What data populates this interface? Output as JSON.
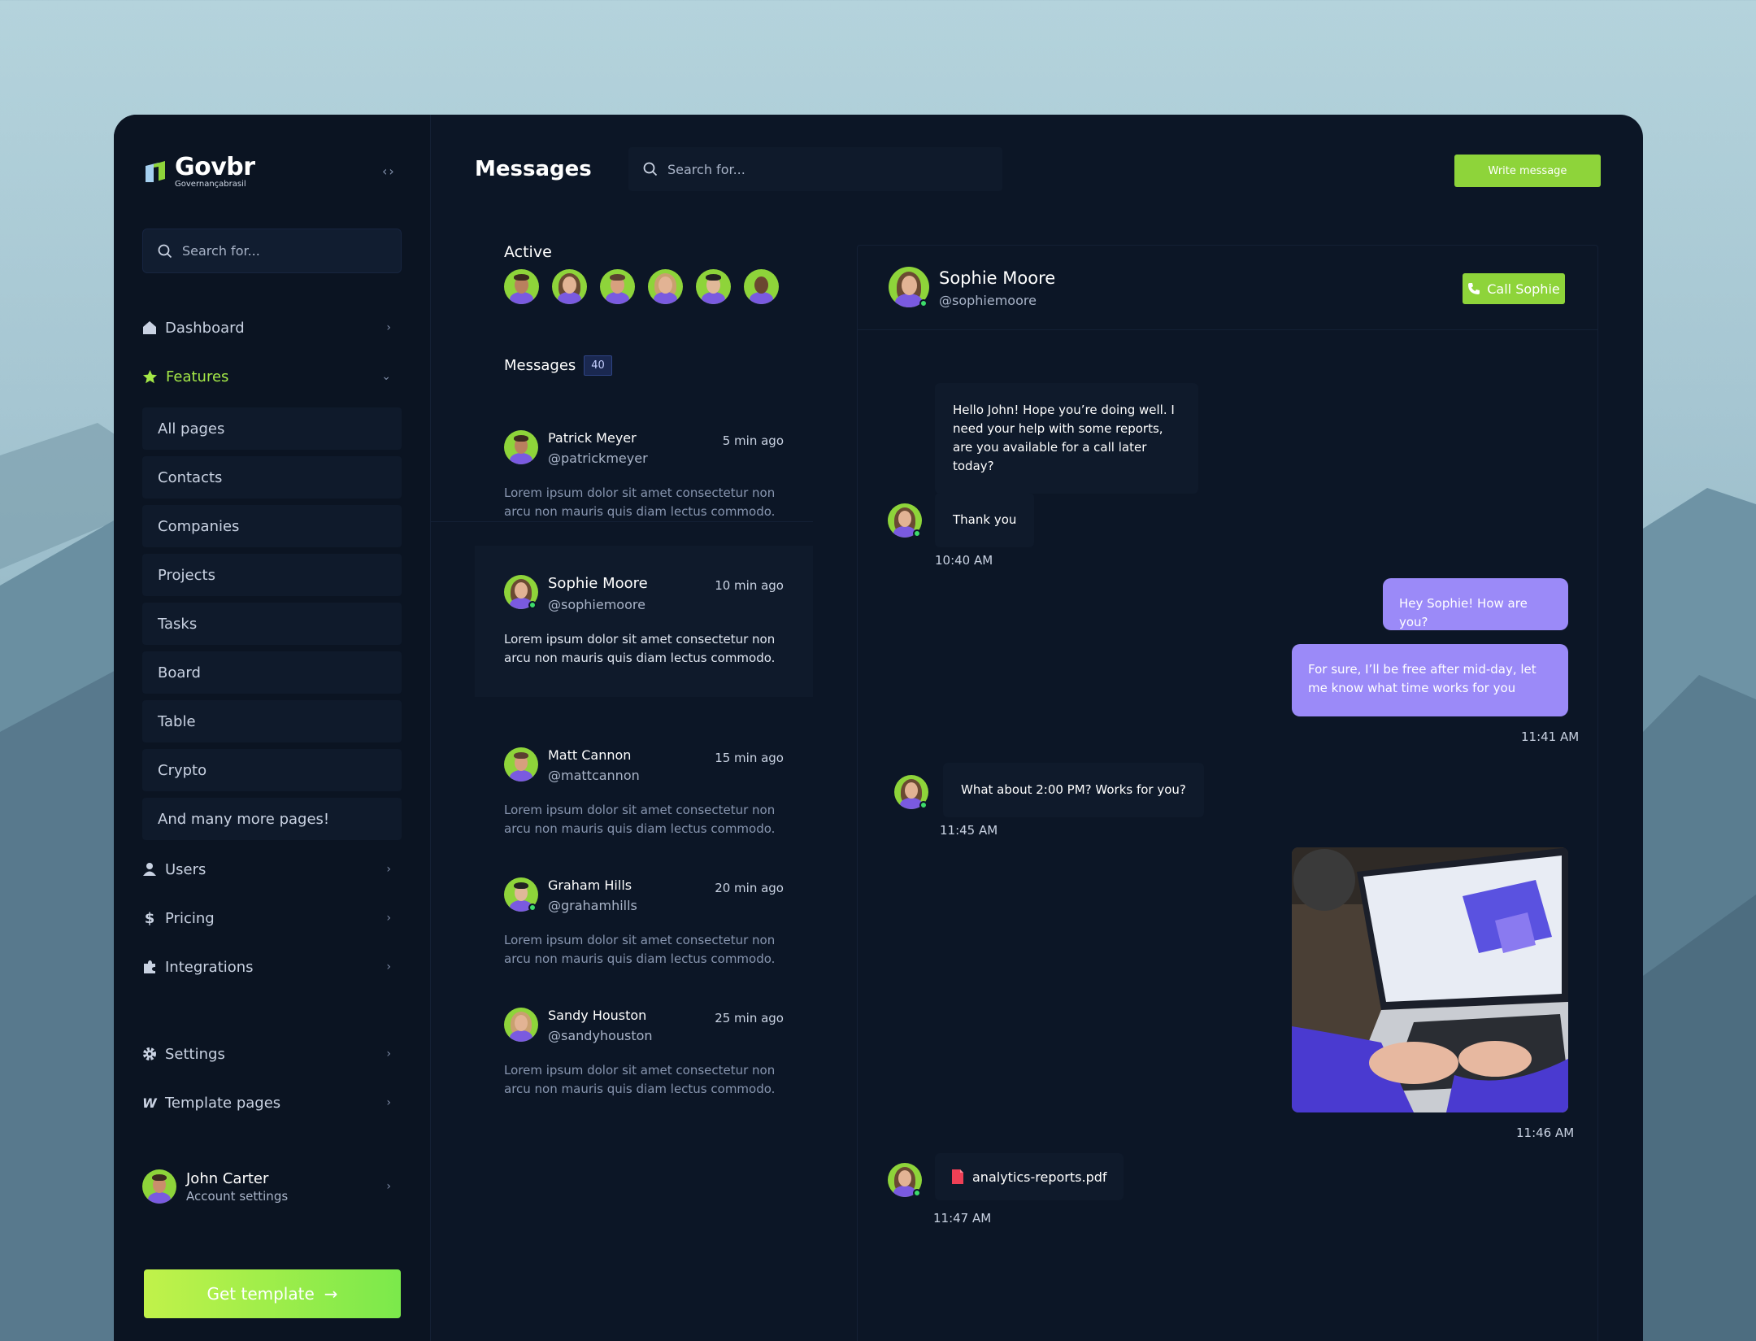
{
  "brand": {
    "name": "Govbr",
    "tagline": "Governançabrasil"
  },
  "colors": {
    "accent": "#8ed43a",
    "bubble_out": "#9b8af8",
    "bg": "#0c1626"
  },
  "sidebar": {
    "search_placeholder": "Search for...",
    "nav": [
      {
        "label": "Dashboard",
        "icon": "home-icon"
      },
      {
        "label": "Features",
        "icon": "star-icon"
      },
      {
        "label": "Users",
        "icon": "user-icon"
      },
      {
        "label": "Pricing",
        "icon": "dollar-icon"
      },
      {
        "label": "Integrations",
        "icon": "puzzle-icon"
      },
      {
        "label": "Settings",
        "icon": "gear-icon"
      },
      {
        "label": "Template pages",
        "icon": "webflow-icon"
      }
    ],
    "features_sub": [
      "All pages",
      "Contacts",
      "Companies",
      "Projects",
      "Tasks",
      "Board",
      "Table",
      "Crypto",
      "And many more pages!"
    ],
    "user": {
      "name": "John Carter",
      "subtitle": "Account settings"
    },
    "cta": "Get template"
  },
  "header": {
    "title": "Messages",
    "search_placeholder": "Search for...",
    "write_button": "Write message"
  },
  "active": {
    "label": "Active"
  },
  "messages": {
    "label": "Messages",
    "count": "40",
    "conversations": [
      {
        "name": "Patrick Meyer",
        "handle": "@patrickmeyer",
        "time": "5 min ago",
        "preview": "Lorem ipsum dolor sit amet consectetur non arcu non mauris quis diam lectus commodo."
      },
      {
        "name": "Sophie Moore",
        "handle": "@sophiemoore",
        "time": "10 min ago",
        "preview": "Lorem ipsum dolor sit amet consectetur non arcu non mauris quis diam lectus commodo."
      },
      {
        "name": "Matt Cannon",
        "handle": "@mattcannon",
        "time": "15 min ago",
        "preview": "Lorem ipsum dolor sit amet consectetur non arcu non mauris quis diam lectus commodo."
      },
      {
        "name": "Graham Hills",
        "handle": "@grahamhills",
        "time": "20 min ago",
        "preview": "Lorem ipsum dolor sit amet consectetur non arcu non mauris quis diam lectus commodo."
      },
      {
        "name": "Sandy Houston",
        "handle": "@sandyhouston",
        "time": "25 min ago",
        "preview": "Lorem ipsum dolor sit amet consectetur non arcu non mauris quis diam lectus commodo."
      }
    ]
  },
  "chat": {
    "name": "Sophie Moore",
    "handle": "@sophiemoore",
    "call_button": "Call Sophie",
    "messages": [
      {
        "text": "Hello John! Hope you’re doing well. I need your help with some reports, are you available for a call later today?"
      },
      {
        "text": "Thank you",
        "time": "10:40 AM"
      },
      {
        "text": "Hey Sophie! How are you?"
      },
      {
        "text": "For sure, I’ll be free after mid-day, let me know what time works for you",
        "time": "11:41 AM"
      },
      {
        "text": "What about 2:00 PM? Works for you?",
        "time": "11:45 AM"
      },
      {
        "image": "laptop-photo",
        "time": "11:46 AM"
      },
      {
        "file": "analytics-reports.pdf",
        "time": "11:47 AM"
      }
    ]
  }
}
